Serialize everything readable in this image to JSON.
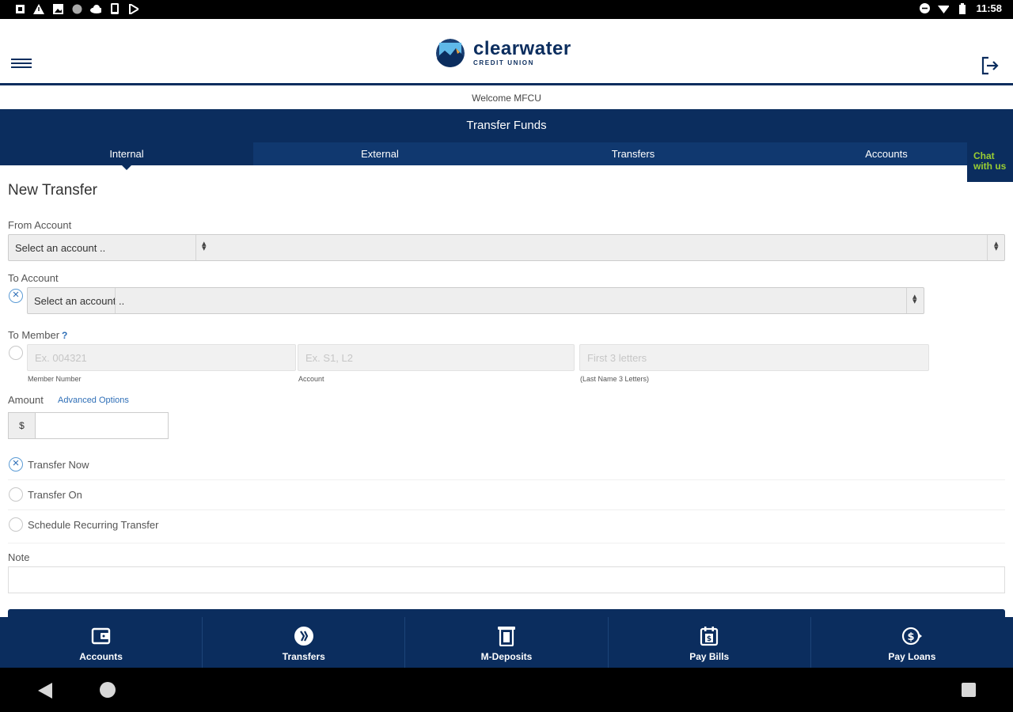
{
  "status_bar": {
    "time": "11:58",
    "left_icons": [
      "notification-icon",
      "warning-icon",
      "image-icon",
      "sync-icon",
      "cloud-icon",
      "phone-icon",
      "play-store-icon"
    ],
    "right_icons": [
      "do-not-disturb-icon",
      "wifi-icon",
      "battery-icon"
    ]
  },
  "header": {
    "logo_main": "clearwater",
    "logo_sub": "CREDIT UNION",
    "welcome": "Welcome MFCU"
  },
  "banner": {
    "title": "Transfer Funds"
  },
  "tabs": [
    {
      "label": "Internal",
      "active": true
    },
    {
      "label": "External",
      "active": false
    },
    {
      "label": "Transfers",
      "active": false
    },
    {
      "label": "Accounts",
      "active": false
    }
  ],
  "chat": {
    "line1": "Chat",
    "line2": "with us"
  },
  "form": {
    "title": "New Transfer",
    "from_account": {
      "label": "From Account",
      "value": "Select an account .."
    },
    "to_account": {
      "label": "To Account",
      "value": "Select an account .."
    },
    "to_member": {
      "label": "To Member",
      "help": "?",
      "member_number": {
        "placeholder": "Ex. 004321",
        "caption": "Member Number"
      },
      "account": {
        "placeholder": "Ex. S1, L2",
        "caption": "Account"
      },
      "last_name": {
        "placeholder": "First  3  letters",
        "caption": "(Last Name  3  Letters)"
      }
    },
    "amount": {
      "label": "Amount",
      "advanced": "Advanced Options",
      "currency": "$",
      "value": ""
    },
    "schedule_options": [
      {
        "label": "Transfer Now",
        "checked": true
      },
      {
        "label": "Transfer On",
        "checked": false
      },
      {
        "label": "Schedule Recurring Transfer",
        "checked": false
      }
    ],
    "note": {
      "label": "Note",
      "value": ""
    }
  },
  "bottom_nav": [
    {
      "label": "Accounts",
      "icon": "wallet-icon"
    },
    {
      "label": "Transfers",
      "icon": "transfer-icon"
    },
    {
      "label": "M-Deposits",
      "icon": "check-deposit-icon"
    },
    {
      "label": "Pay Bills",
      "icon": "calendar-bill-icon"
    },
    {
      "label": "Pay Loans",
      "icon": "dollar-arrow-icon"
    }
  ],
  "colors": {
    "brand_navy": "#0b2d5e",
    "chat_green": "#9acd32",
    "link_blue": "#2f6fb7"
  }
}
